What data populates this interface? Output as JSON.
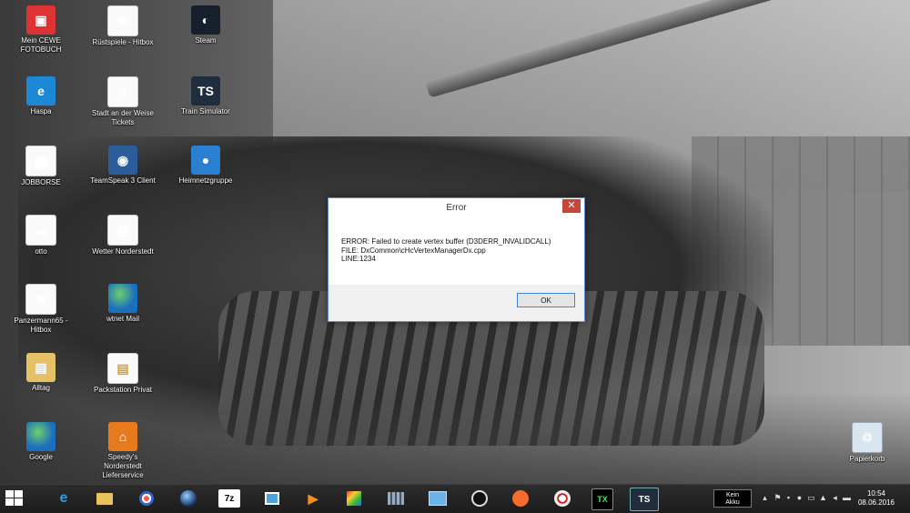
{
  "desktop": {
    "icons": [
      {
        "label": "Mein CEWE FOTOBUCH",
        "icon": "photobook-icon"
      },
      {
        "label": "Haspa",
        "icon": "internet-explorer-icon"
      },
      {
        "label": "JOBBORSE",
        "icon": "pdf-document-icon"
      },
      {
        "label": "otto",
        "icon": "pdf-document-icon"
      },
      {
        "label": "Panzermann65 - Hitbox",
        "icon": "android-document-icon"
      },
      {
        "label": "Alltag",
        "icon": "folder-icon"
      },
      {
        "label": "Google",
        "icon": "globe-icon"
      },
      {
        "label": "Rüstspiele - Hitbox",
        "icon": "android-document-icon"
      },
      {
        "label": "Stadt an der Weise Tickets",
        "icon": "v-document-icon"
      },
      {
        "label": "TeamSpeak 3 Client",
        "icon": "teamspeak-icon"
      },
      {
        "label": "Wetter Norderstedt",
        "icon": "document-icon"
      },
      {
        "label": "wtnet Mail",
        "icon": "globe-icon"
      },
      {
        "label": "Packstation Privat",
        "icon": "document-icon"
      },
      {
        "label": "Speedy's Norderstedt Lieferservice",
        "icon": "food-delivery-icon"
      },
      {
        "label": "Steam",
        "icon": "steam-icon"
      },
      {
        "label": "Train Simulator",
        "icon": "train-simulator-icon"
      },
      {
        "label": "Heimnetzgruppe",
        "icon": "homegroup-icon"
      },
      {
        "label": "Papierkorb",
        "icon": "recycle-bin-icon"
      }
    ]
  },
  "dialog": {
    "title": "Error",
    "close_label": "✕",
    "lines": [
      "ERROR: Failed to create vertex buffer (D3DERR_INVALIDCALL)",
      "FILE: DxCommon\\cHcVertexManagerDx.cpp",
      "LINE:1234"
    ],
    "ok_label": "OK"
  },
  "taskbar": {
    "apps": [
      {
        "name": "internet-explorer",
        "glyph": "e"
      },
      {
        "name": "file-explorer",
        "glyph": ""
      },
      {
        "name": "paint",
        "glyph": ""
      },
      {
        "name": "google-earth",
        "glyph": ""
      },
      {
        "name": "7zip",
        "glyph": "7z"
      },
      {
        "name": "photos",
        "glyph": ""
      },
      {
        "name": "media-player",
        "glyph": "▶"
      },
      {
        "name": "paint-brush",
        "glyph": ""
      },
      {
        "name": "network-monitor",
        "glyph": ""
      },
      {
        "name": "remote-desktop",
        "glyph": ""
      },
      {
        "name": "obs",
        "glyph": ""
      },
      {
        "name": "origin",
        "glyph": ""
      },
      {
        "name": "compass",
        "glyph": ""
      },
      {
        "name": "opentx",
        "glyph": "TX"
      },
      {
        "name": "train-simulator",
        "glyph": "TS"
      }
    ],
    "battery_line1": "Kein",
    "battery_line2": "Akku",
    "time": "10:54",
    "date": "08.06.2016"
  }
}
